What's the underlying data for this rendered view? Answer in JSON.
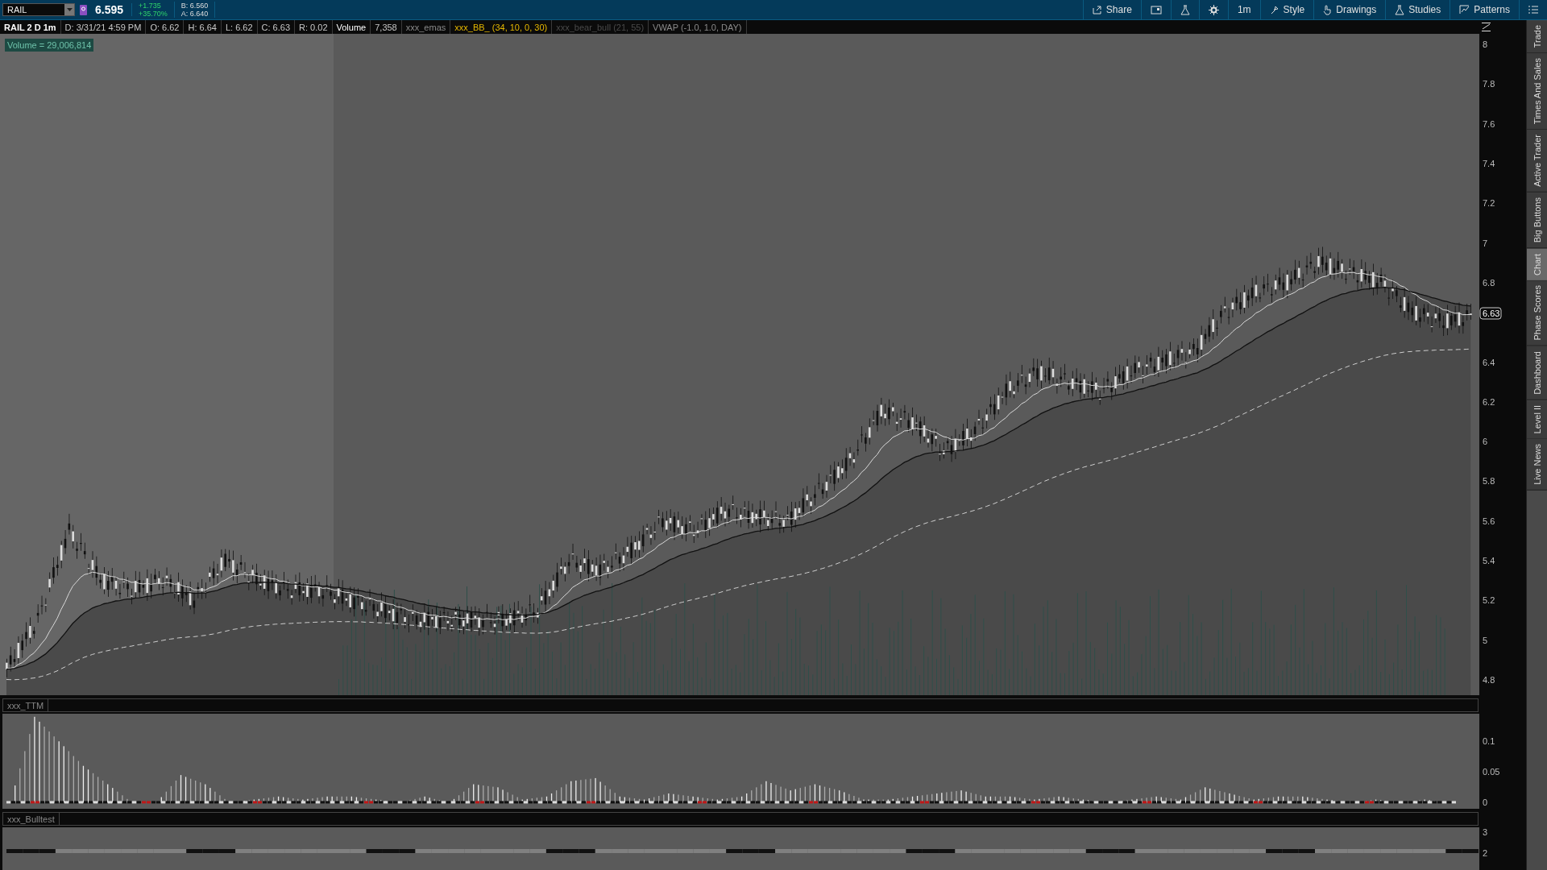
{
  "top_bar": {
    "symbol": "RAIL",
    "last_price": "6.595",
    "change": "+1.735",
    "change_percent": "+35.70%",
    "bid": "B: 6.560",
    "ask": "A: 6.640",
    "toolbar": [
      {
        "kind": "labeled",
        "label": "Share"
      },
      {
        "kind": "icon"
      },
      {
        "kind": "icon"
      },
      {
        "kind": "icon"
      },
      {
        "kind": "labeled",
        "label": "1m"
      },
      {
        "kind": "labeled",
        "label": "Style"
      },
      {
        "kind": "labeled",
        "label": "Drawings"
      },
      {
        "kind": "labeled",
        "label": "Studies"
      },
      {
        "kind": "labeled",
        "label": "Patterns"
      },
      {
        "kind": "icon"
      }
    ]
  },
  "chart_header": [
    {
      "text": "RAIL 2 D 1m",
      "kind": "title"
    },
    {
      "text": "D: 3/31/21 4:59 PM",
      "kind": "value"
    },
    {
      "text": "O: 6.62",
      "kind": "value"
    },
    {
      "text": "H: 6.64",
      "kind": "value"
    },
    {
      "text": "L: 6.62",
      "kind": "value"
    },
    {
      "text": "C: 6.63",
      "kind": "value"
    },
    {
      "text": "R: 0.02",
      "kind": "value"
    },
    {
      "text": "Volume",
      "kind": "label"
    },
    {
      "text": "7,358",
      "kind": "value"
    },
    {
      "text": "xxx_emas",
      "kind": "study"
    },
    {
      "text": "xxx_BB_ (34, 10, 0, 30)",
      "kind": "highlight"
    },
    {
      "text": "xxx_bear_bull (21, 55)",
      "kind": "hidden"
    },
    {
      "text": "VWAP (-1.0, 1.0, DAY)",
      "kind": "study"
    }
  ],
  "price_panel": {
    "volume_label": "Volume = 29,006,814",
    "last_price_tag": "6.63",
    "axis_labels": [
      "8",
      "7.8",
      "7.6",
      "7.4",
      "7.2",
      "7",
      "6.8",
      "6.4",
      "6.2",
      "6",
      "5.8",
      "5.6",
      "5.4",
      "5.2",
      "5",
      "4.8"
    ]
  },
  "ttm_panel": {
    "title": "xxx_TTM",
    "axis_labels": [
      "0.1",
      "0.05",
      "0"
    ]
  },
  "bulltest_panel": {
    "title": "xxx_Bulltest",
    "axis_labels": [
      "3",
      "2"
    ]
  },
  "side_tabs": [
    {
      "label": "Trade",
      "selected": false
    },
    {
      "label": "Times And Sales",
      "selected": false
    },
    {
      "label": "Active Trader",
      "selected": false
    },
    {
      "label": "Big Buttons",
      "selected": false
    },
    {
      "label": "Chart",
      "selected": true
    },
    {
      "label": "Phase Scores",
      "selected": false
    },
    {
      "label": "Dashboard",
      "selected": false
    },
    {
      "label": "Level II",
      "selected": false
    },
    {
      "label": "Live News",
      "selected": false
    }
  ]
}
